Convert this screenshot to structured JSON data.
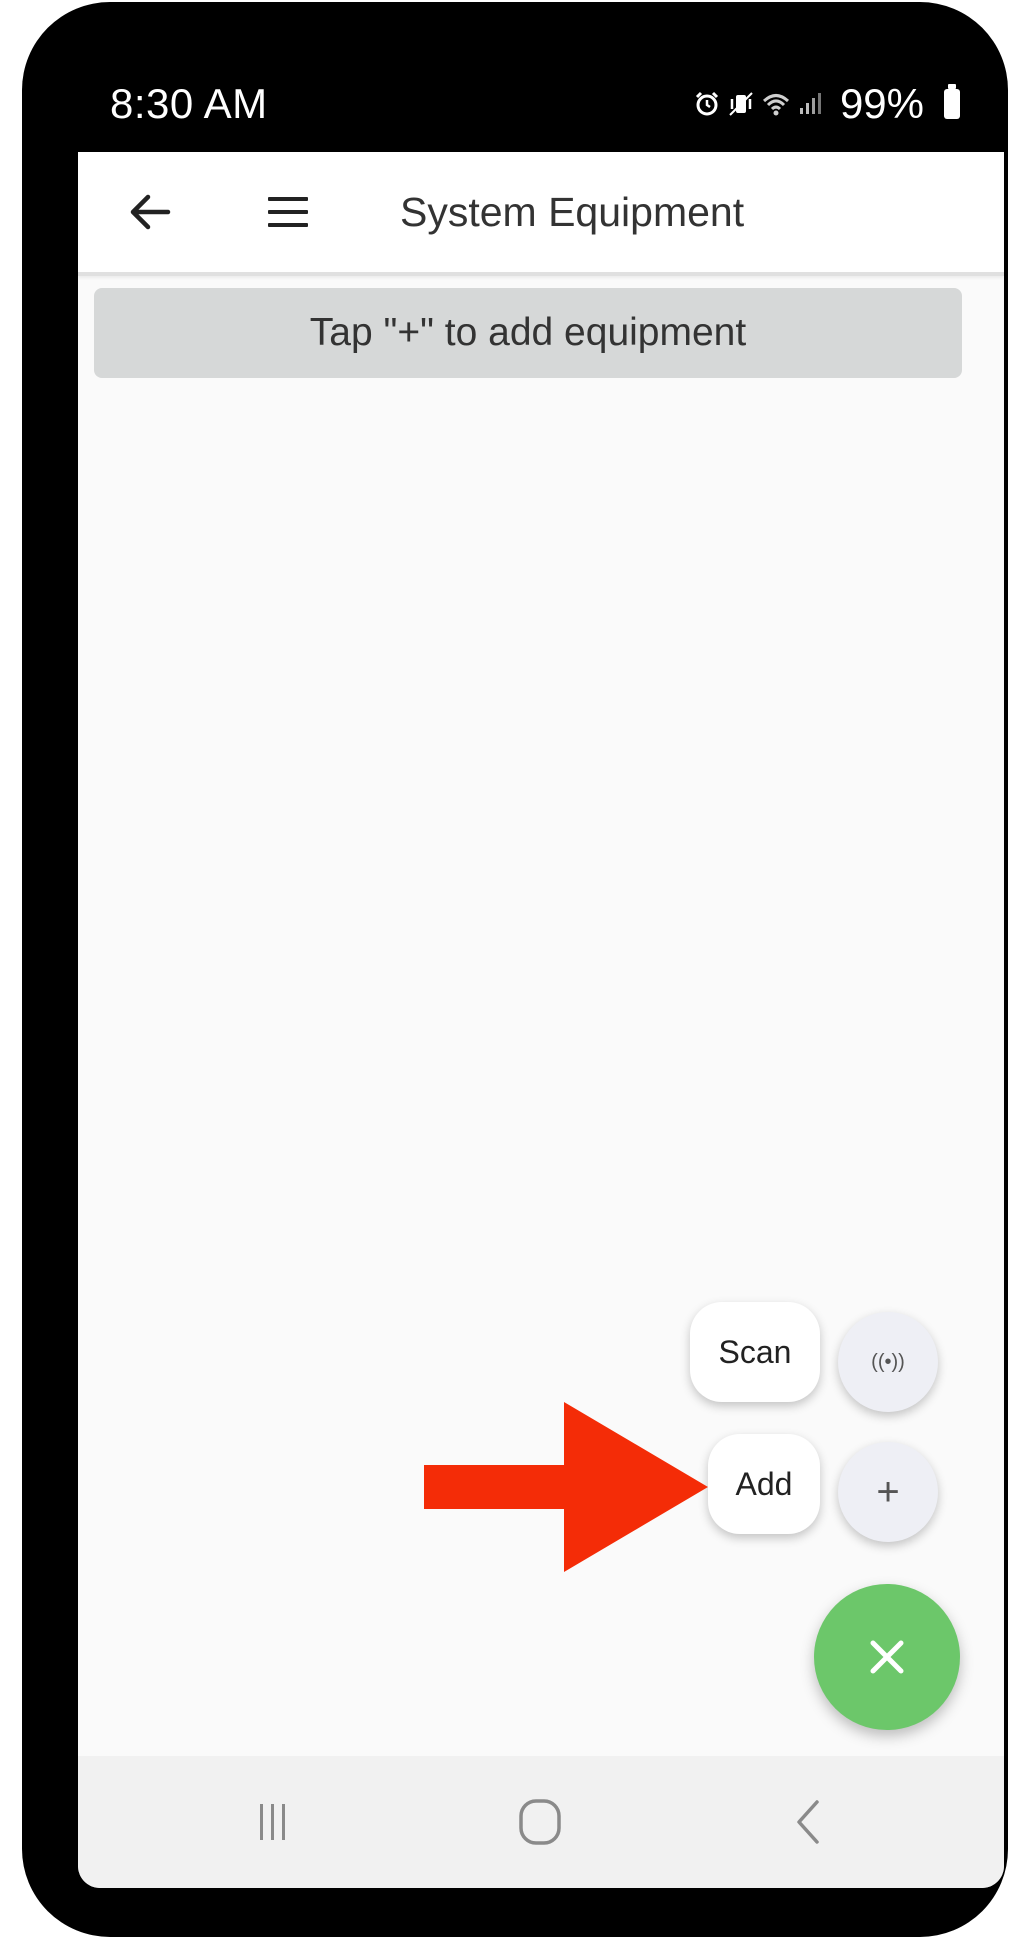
{
  "status_bar": {
    "time": "8:30 AM",
    "battery_text": "99%",
    "icons": [
      "alarm-icon",
      "vibrate-mute-icon",
      "wifi-icon",
      "signal-icon",
      "battery-icon"
    ]
  },
  "app_bar": {
    "title": "System Equipment",
    "icons": [
      "back-arrow-icon",
      "hamburger-menu-icon"
    ]
  },
  "banner": {
    "text": "Tap \"+\" to add equipment"
  },
  "fab_menu": {
    "scan_label": "Scan",
    "add_label": "Add",
    "scan_icon_text": "((•))",
    "add_icon_text": "+",
    "main_icon": "close-icon",
    "main_color": "#6cc76a"
  },
  "annotation": {
    "arrow_color": "#f42c07",
    "points_to": "Add"
  },
  "nav_bar": {
    "icons": [
      "recents-icon",
      "home-icon",
      "nav-back-icon"
    ]
  }
}
